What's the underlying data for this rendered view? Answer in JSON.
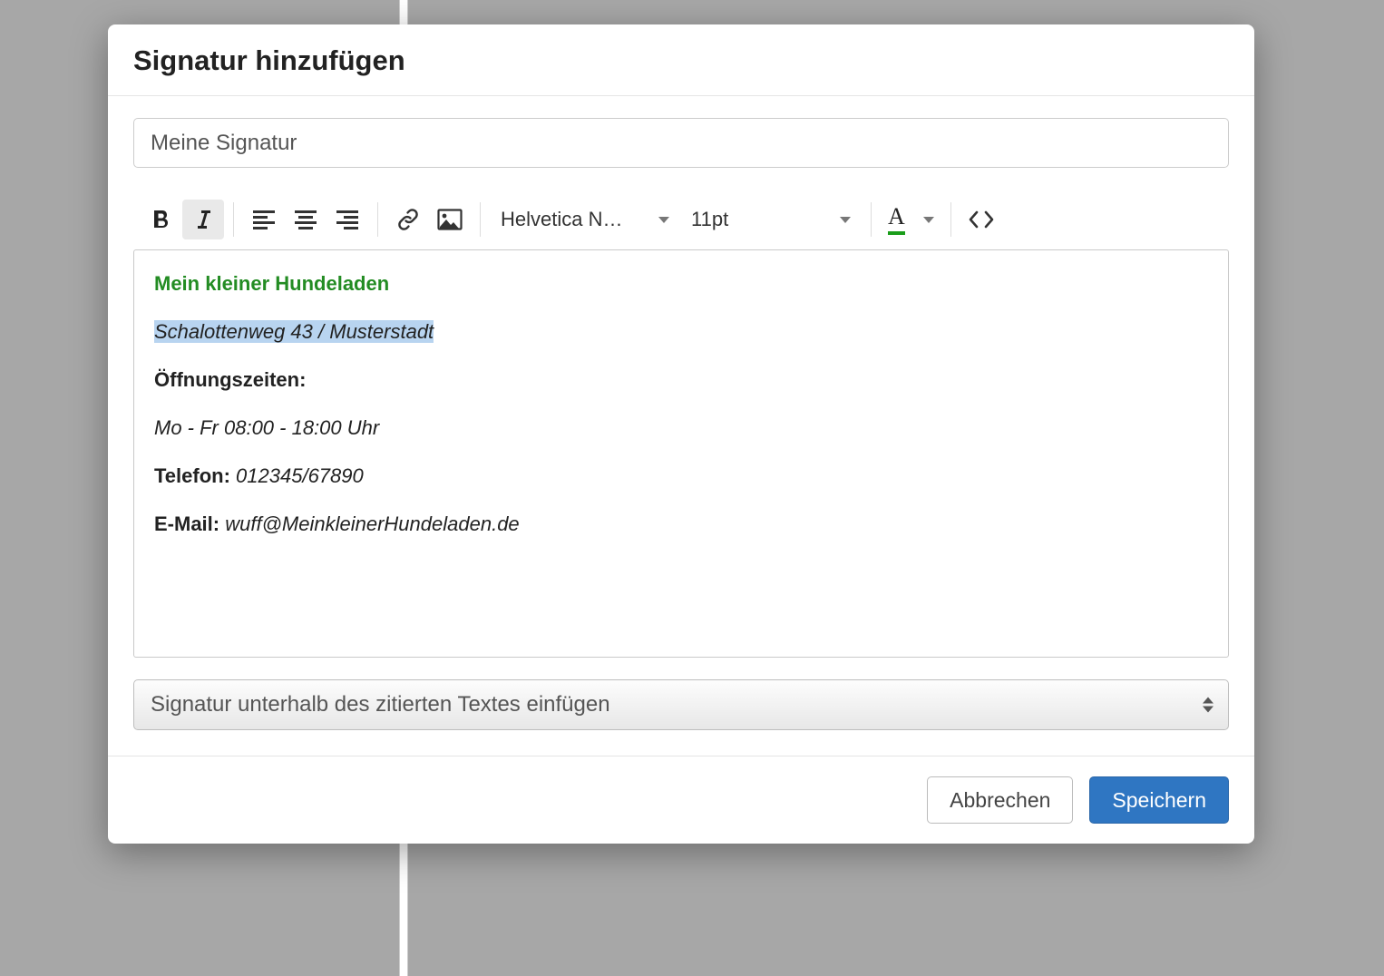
{
  "modal": {
    "title": "Signatur hinzufügen",
    "name_value": "Meine Signatur",
    "toolbar": {
      "font_family": "Helvetica N…",
      "font_size": "11pt",
      "text_color": "#1a9d1a"
    },
    "signature": {
      "title": "Mein kleiner Hundeladen",
      "title_color": "#238c23",
      "address": "Schalottenweg 43 / Musterstadt",
      "hours_label": "Öffnungszeiten:",
      "hours_value": "Mo - Fr 08:00 - 18:00 Uhr",
      "phone_label": "Telefon:",
      "phone_value": "012345/67890",
      "email_label": "E-Mail:",
      "email_value": "wuff@MeinkleinerHundeladen.de"
    },
    "placement_selected": "Signatur unterhalb des zitierten Textes einfügen",
    "buttons": {
      "cancel": "Abbrechen",
      "save": "Speichern"
    }
  }
}
